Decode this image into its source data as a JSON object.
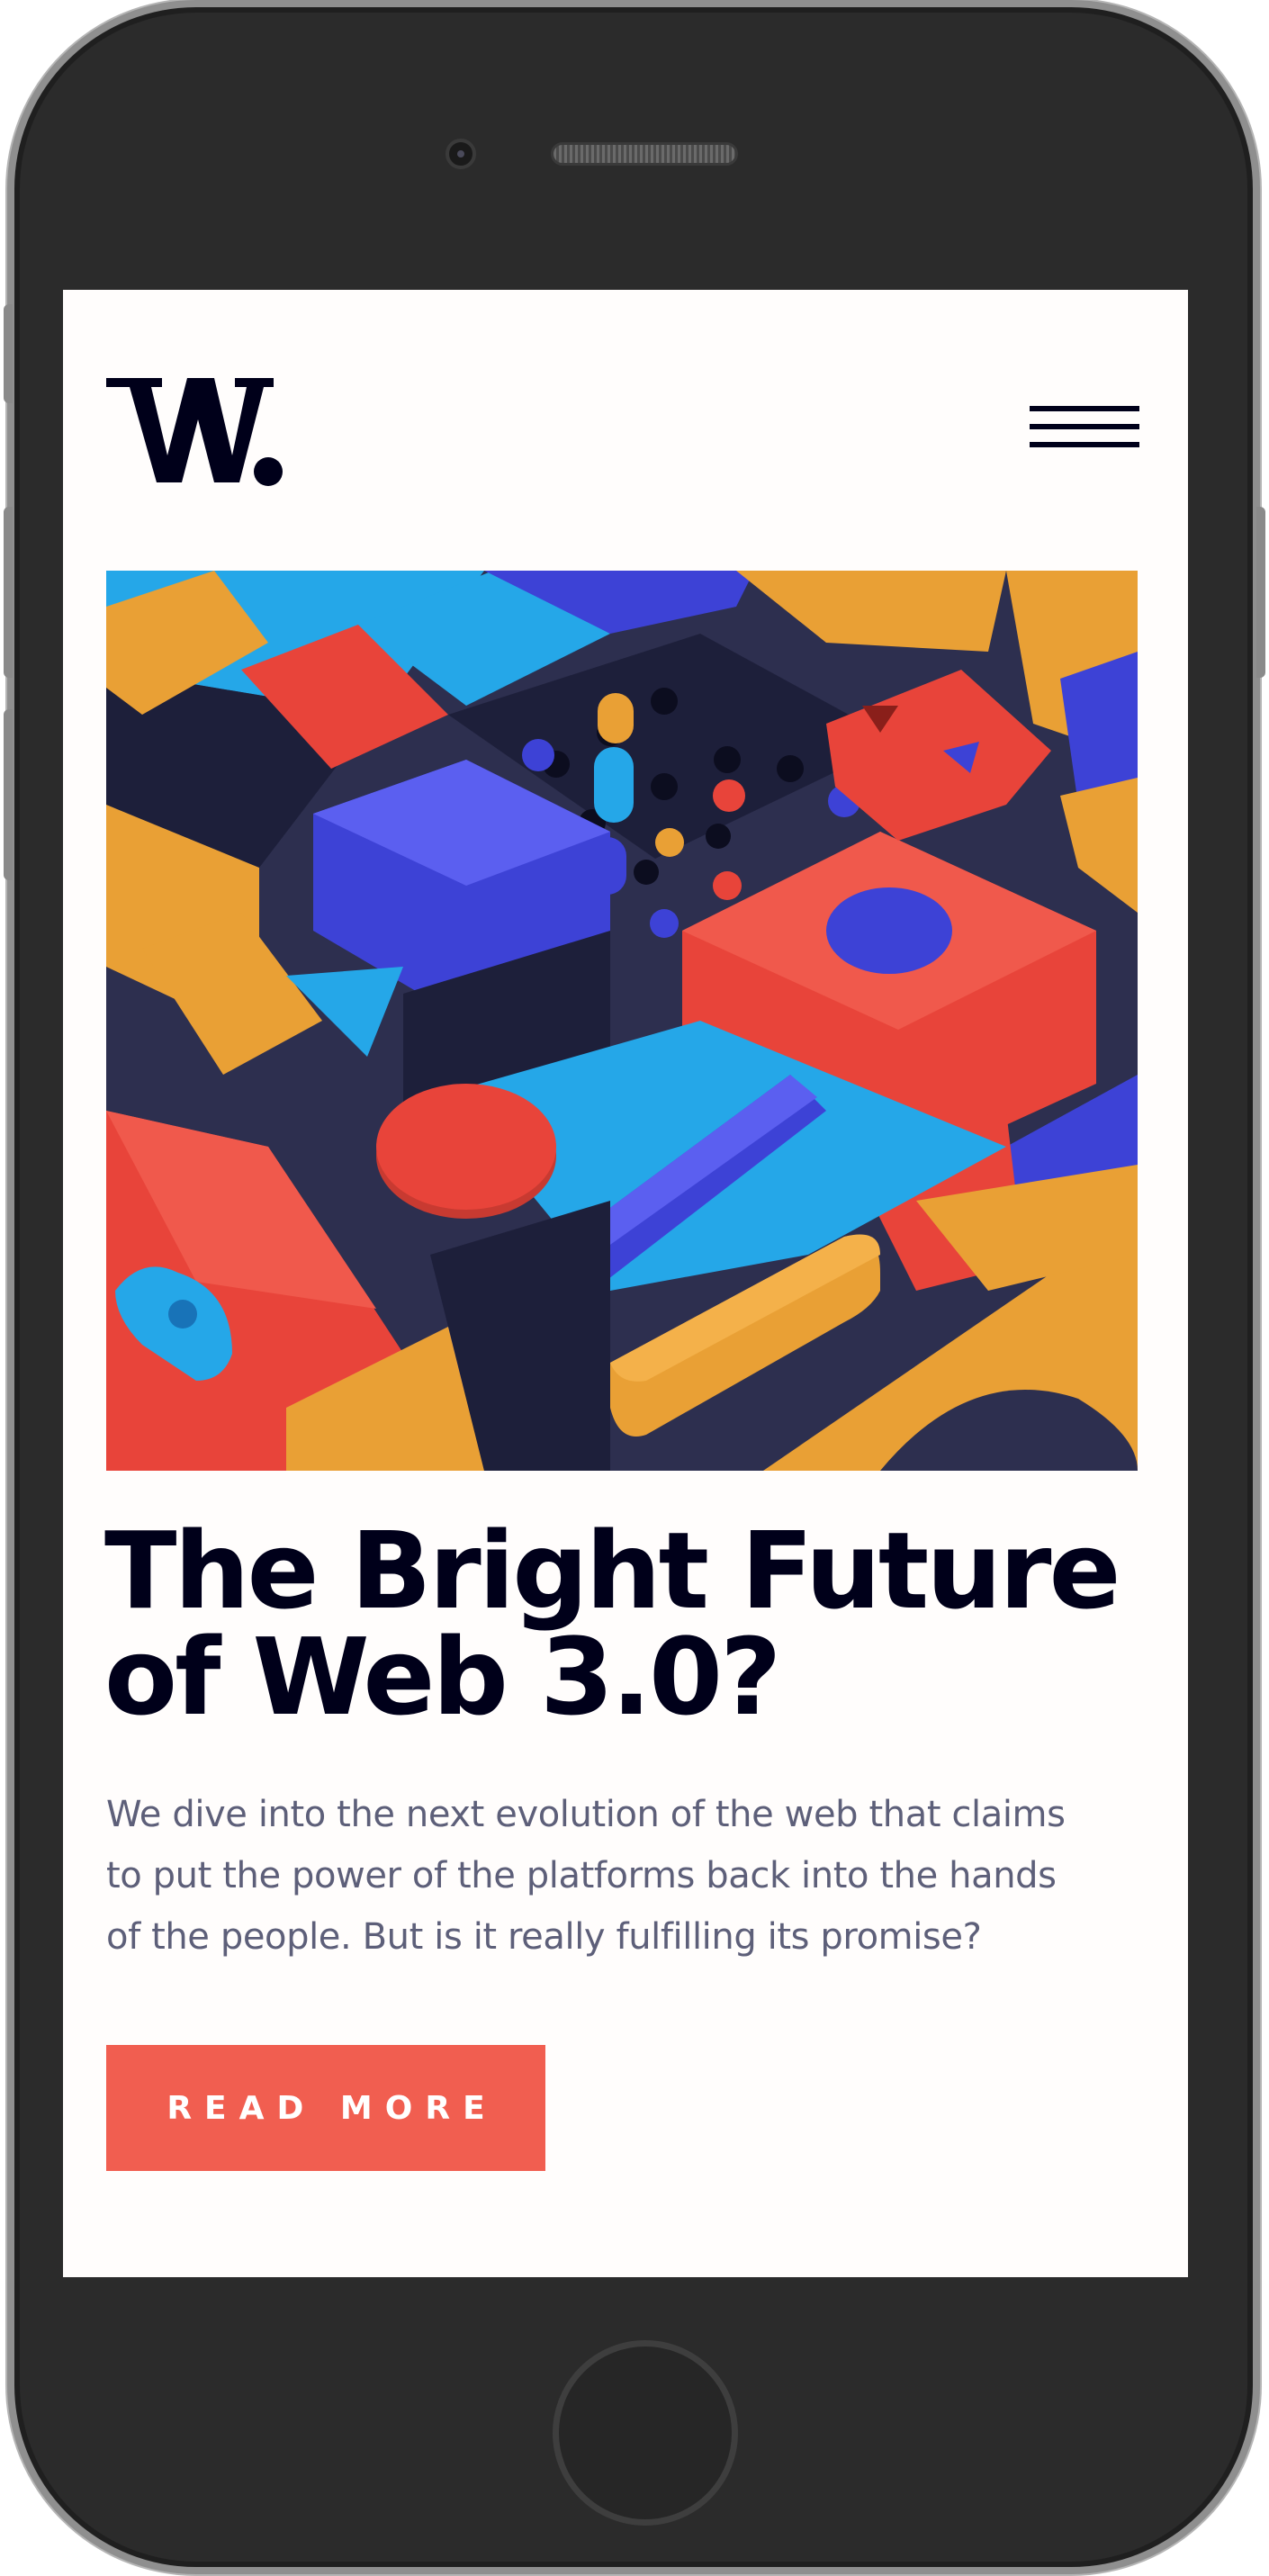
{
  "header": {
    "logo_icon": "w-logo-icon",
    "menu_icon": "hamburger-menu-icon"
  },
  "hero": {
    "image_icon": "abstract-3d-shapes-illustration",
    "title_line_1": "The Bright Future",
    "title_line_2": "of Web 3.0?",
    "description_line_1": "We dive into the next evolution of the web that claims",
    "description_line_2": "to put the power of the platforms back into the hands",
    "description_line_3": "of the people. But is it really fulfilling its promise?",
    "cta_label": "READ MORE"
  },
  "colors": {
    "accent": "#f15e50",
    "text_dark": "#00001a",
    "text_muted": "#5d5f79",
    "background": "#fffdfc",
    "shape_orange": "#e9a035",
    "shape_red": "#e8443a",
    "shape_blue": "#3d42d6",
    "shape_cyan": "#25a7e8",
    "shape_navy": "#2d2f4f"
  }
}
